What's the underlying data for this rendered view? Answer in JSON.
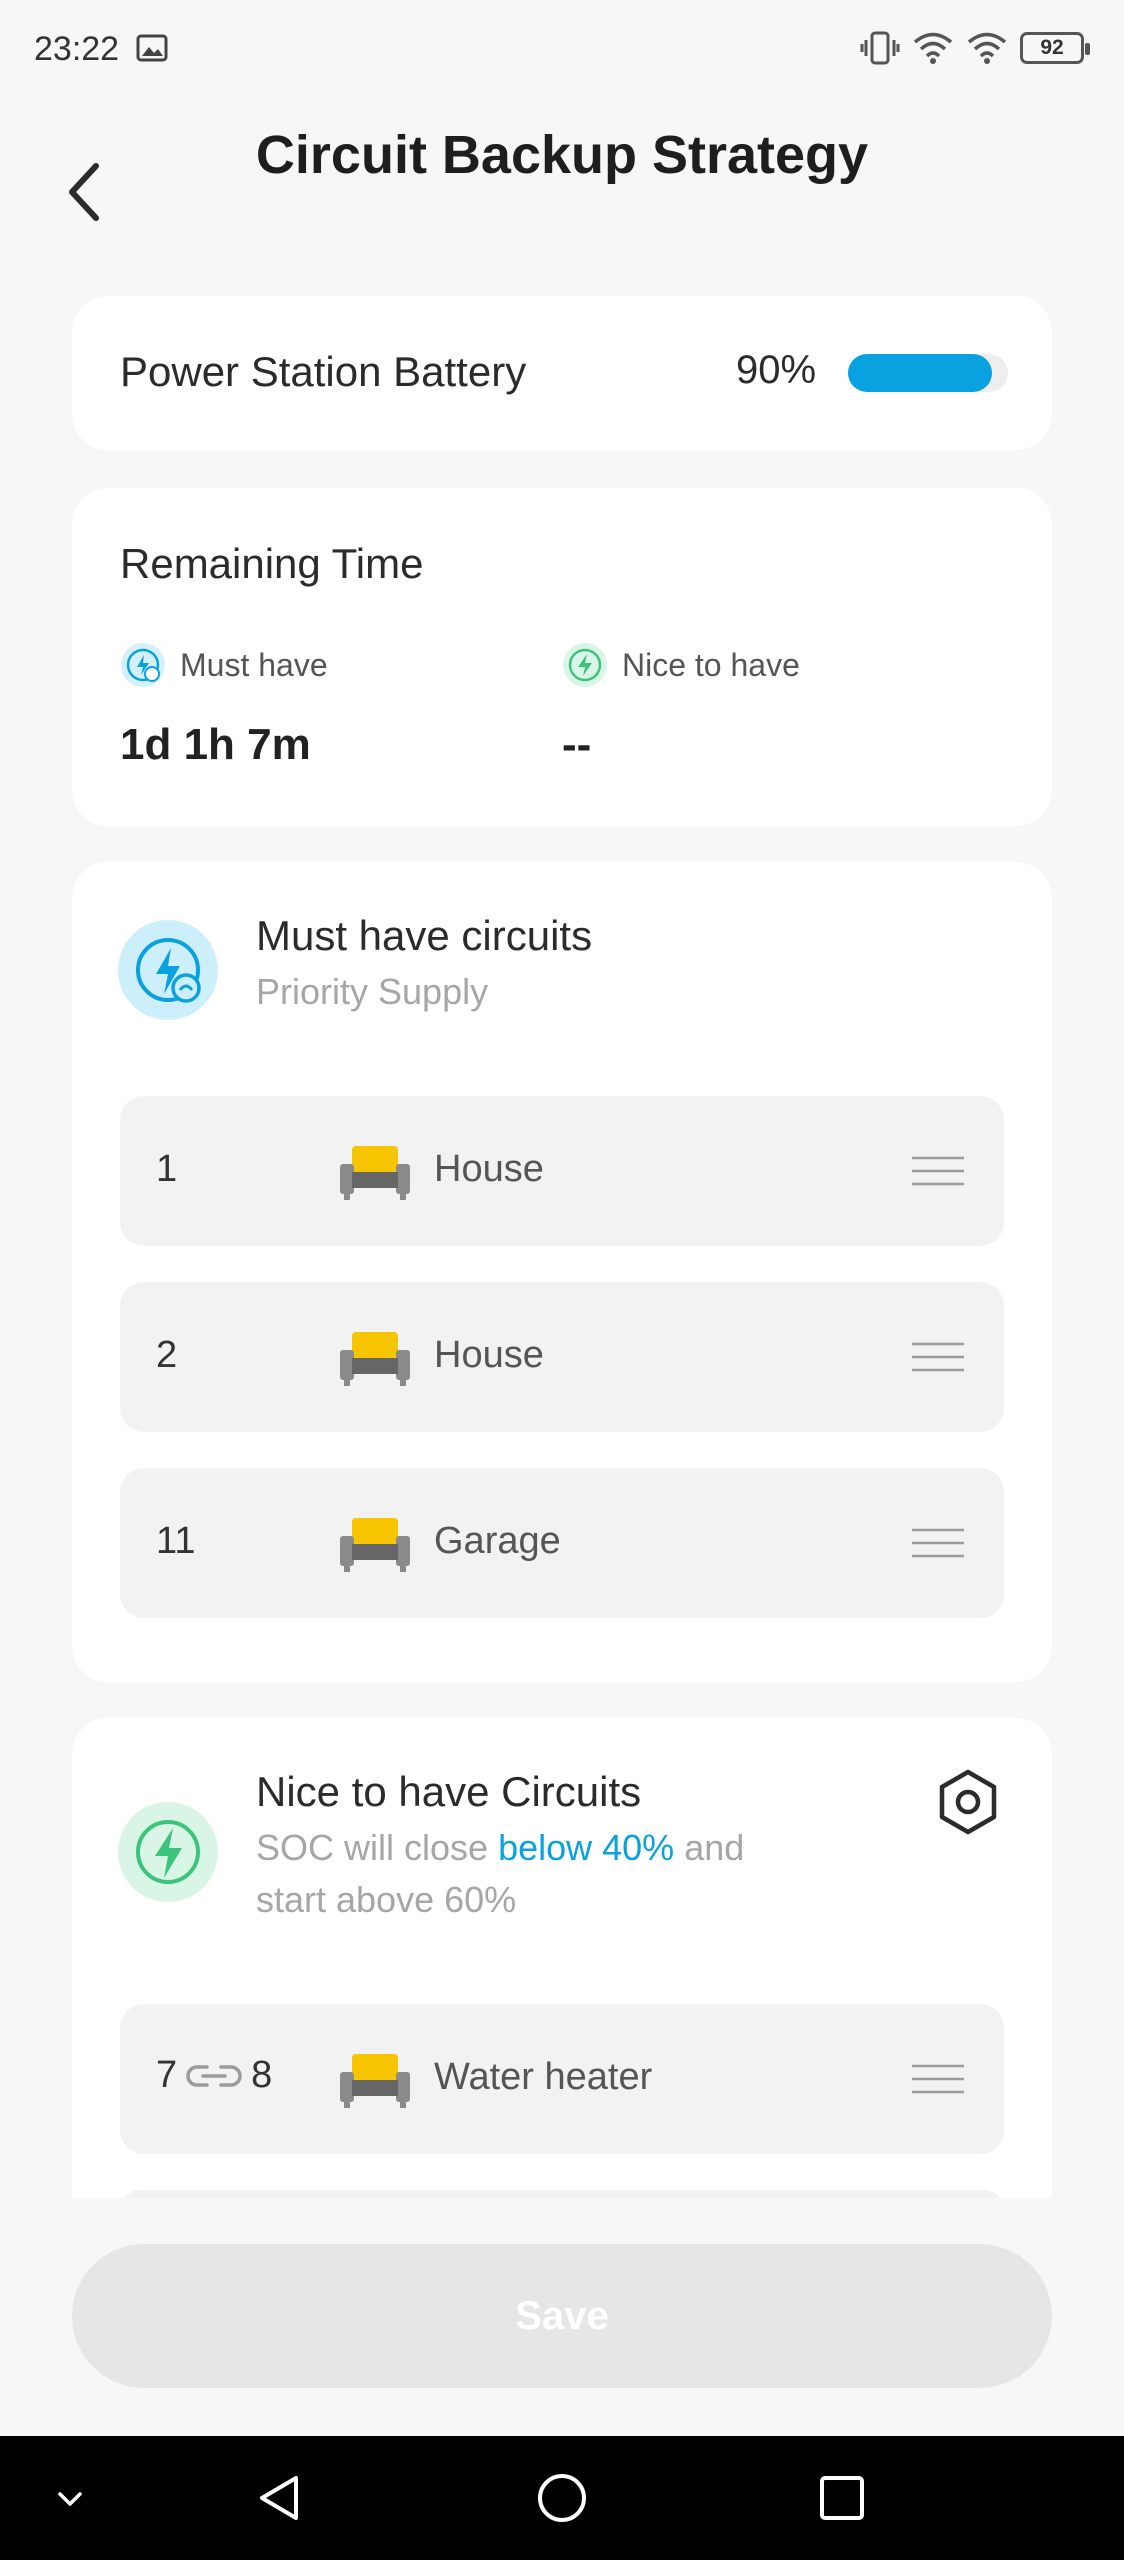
{
  "status_bar": {
    "time": "23:22",
    "battery_level": "92",
    "icons": [
      "image-icon",
      "vibrate-icon",
      "wifi-icon",
      "wifi-icon",
      "battery-icon"
    ]
  },
  "header": {
    "title": "Circuit Backup Strategy",
    "back_icon": "chevron-left-icon"
  },
  "battery_card": {
    "label": "Power Station Battery",
    "percent_text": "90%",
    "percent_value": 0.9,
    "bar_color": "#0aa1e0"
  },
  "remaining_time": {
    "title": "Remaining Time",
    "must_have": {
      "label": "Must have",
      "value": "1d 1h 7m",
      "icon": "bolt-clock-icon"
    },
    "nice_to_have": {
      "label": "Nice to have",
      "value": "--",
      "icon": "bolt-icon"
    }
  },
  "must_have_section": {
    "title": "Must have circuits",
    "subtitle": "Priority Supply",
    "icon": "bolt-clock-icon",
    "rows": [
      {
        "number": "1",
        "label": "House",
        "icon": "sofa-icon"
      },
      {
        "number": "2",
        "label": "House",
        "icon": "sofa-icon"
      },
      {
        "number": "11",
        "label": "Garage",
        "icon": "sofa-icon"
      }
    ]
  },
  "nice_section": {
    "title": "Nice to have Circuits",
    "subtitle_pre": "SOC will close ",
    "subtitle_highlight": "below 40%",
    "subtitle_mid": " and",
    "subtitle_line2": "start above 60%",
    "icon": "bolt-icon",
    "settings_icon": "hexagon-settings-icon",
    "rows": [
      {
        "number_a": "7",
        "number_b": "8",
        "label": "Water heater",
        "icon": "sofa-icon",
        "link_icon": "link-icon"
      }
    ]
  },
  "save_label": "Save",
  "nav_bar": {
    "icons": [
      "chevron-down-icon",
      "back-triangle-icon",
      "home-circle-icon",
      "recents-square-icon"
    ]
  },
  "colors": {
    "accent": "#0aa1e0",
    "green": "#3cc47c",
    "sofa_yellow": "#f7c500",
    "sofa_gray": "#777777"
  }
}
